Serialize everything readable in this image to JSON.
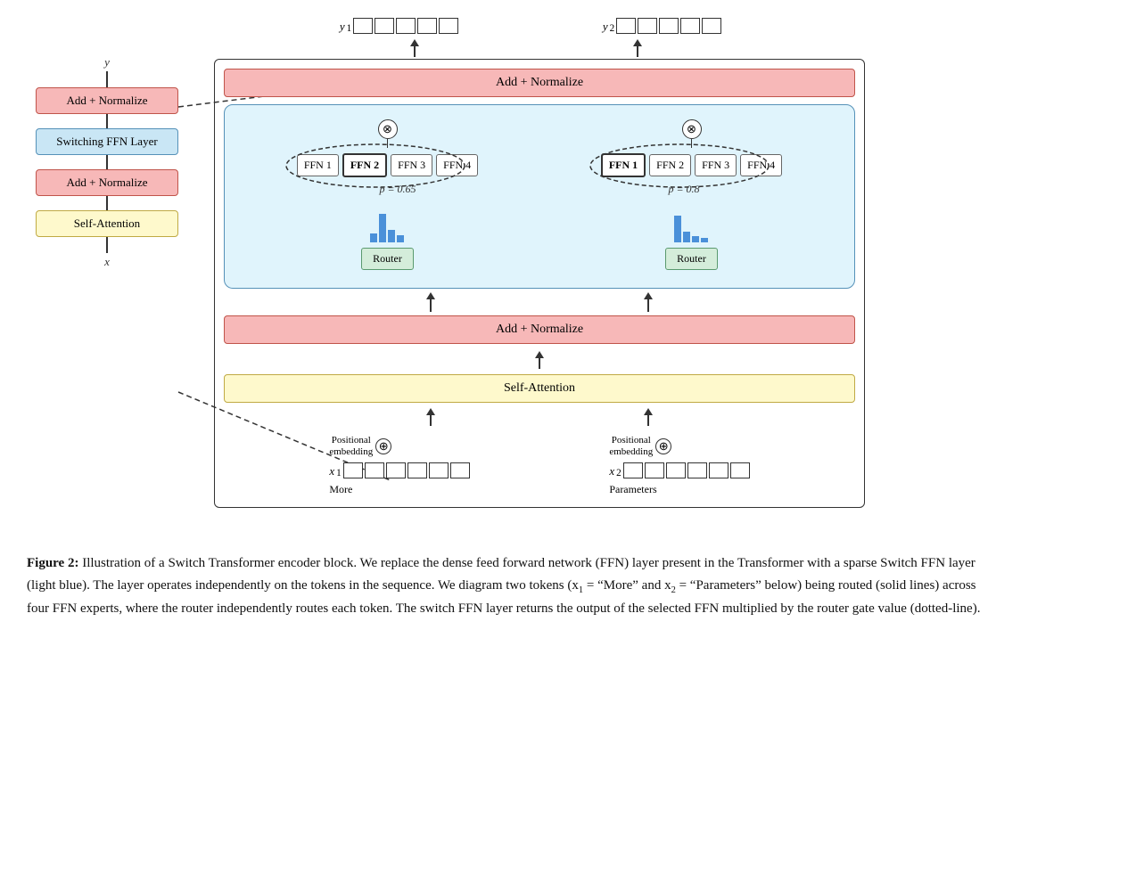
{
  "left_diagram": {
    "y_label": "y",
    "x_label": "x",
    "add_normalize_top": "Add + Normalize",
    "switching_ffn": "Switching FFN Layer",
    "add_normalize_bottom": "Add + Normalize",
    "self_attention": "Self-Attention"
  },
  "right_diagram": {
    "y1_label": "y",
    "y1_sub": "1",
    "y2_label": "y",
    "y2_sub": "2",
    "add_normalize_top": "Add + Normalize",
    "add_normalize_bottom": "Add + Normalize",
    "self_attention": "Self-Attention",
    "switch_ffn_label": "Switching FFN Layer",
    "ffn_group1": [
      "FFN 1",
      "FFN 2",
      "FFN 3",
      "FFN 4"
    ],
    "ffn_group2": [
      "FFN 1",
      "FFN 2",
      "FFN 3",
      "FFN 4"
    ],
    "ffn_bold1": 1,
    "ffn_bold2": 0,
    "p1": "p = 0.65",
    "p2": "p = 0.8",
    "router_label": "Router",
    "x1_label": "x",
    "x1_sub": "1",
    "x2_label": "x",
    "x2_sub": "2",
    "positional_embedding1": "Positional\nembedding",
    "positional_embedding2": "Positional\nembedding",
    "more_label": "More",
    "parameters_label": "Parameters"
  },
  "caption": {
    "figure_number": "Figure 2:",
    "text": "Illustration of a Switch Transformer encoder block.  We replace the dense feed forward network (FFN) layer present in the Transformer with a sparse Switch FFN layer (light blue).  The layer operates independently on the tokens in the sequence.  We diagram two tokens (x₁ = “More” and x₂ = “Parameters” below) being routed (solid lines) across four FFN experts, where the router independently routes each token.  The switch FFN layer returns the output of the selected FFN multiplied by the router gate value (dotted-line)."
  }
}
